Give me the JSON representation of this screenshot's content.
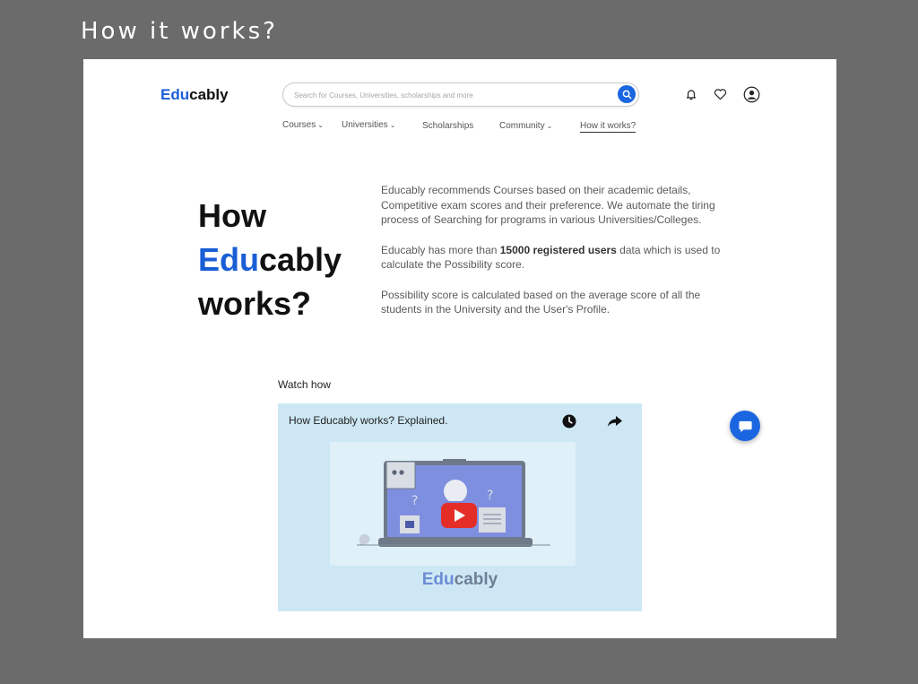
{
  "slide_title": "How it works?",
  "header": {
    "logo": {
      "part1": "Edu",
      "part2": "cably"
    },
    "search": {
      "placeholder": "Search for Courses, Universities, scholarships and more"
    },
    "icons": [
      "search-icon",
      "bell-icon",
      "heart-icon",
      "user-icon"
    ]
  },
  "nav": {
    "items": [
      {
        "label": "Courses"
      },
      {
        "label": "Universities"
      },
      {
        "label": "Scholarships"
      },
      {
        "label": "Community"
      },
      {
        "label": "How it works?"
      }
    ],
    "dropdown_marker": "⌄"
  },
  "hero": {
    "line1": "How",
    "line2_part1": "Edu",
    "line2_part2": "cably",
    "line3": "works?"
  },
  "description": {
    "p1": "Educably recommends Courses based on their academic details, Competitive exam scores and their preference. We automate the tiring process of Searching for programs in various Universities/Colleges.",
    "p2_before": "Educably has more than ",
    "p2_bold": "15000 registered users",
    "p2_after": " data which is used to calculate the Possibility score.",
    "p3": "Possibility score is calculated based on the average score of all the students in the University and the User's Profile."
  },
  "video": {
    "section_label": "Watch how",
    "title": "How Educably works? Explained.",
    "logo_part1": "Edu",
    "logo_part2": "cably",
    "question_mark": "?",
    "icons": [
      "clock-icon",
      "share-icon",
      "play-icon"
    ]
  },
  "chat": {
    "icon": "chat-icon"
  },
  "colors": {
    "brand_blue": "#1a5ed6",
    "button_blue": "#1a66e0",
    "frame_gray": "#6b6b6b",
    "video_bg": "#cde8f4",
    "youtube_red": "#e52d27"
  }
}
